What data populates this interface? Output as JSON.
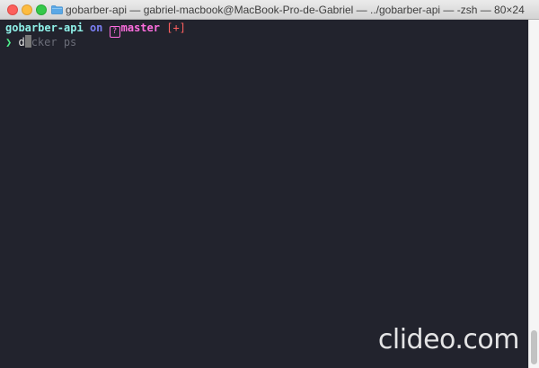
{
  "window": {
    "title": "gobarber-api — gabriel-macbook@MacBook-Pro-de-Gabriel — ../gobarber-api — -zsh — 80×24",
    "folder_icon": "folder-icon"
  },
  "prompt": {
    "directory": "gobarber-api",
    "on_word": "on",
    "branch_icon": "?",
    "branch": "master",
    "status": "[+]",
    "prompt_symbol": "❯",
    "typed": "d",
    "suggestion": "cker ps"
  },
  "watermark": {
    "text": "clideo.com"
  },
  "colors": {
    "background": "#22232d",
    "directory": "#8ff0e8",
    "on": "#7b7ff3",
    "branch": "#ff6ee0",
    "status": "#ff5f5f",
    "prompt": "#4ef08c"
  }
}
